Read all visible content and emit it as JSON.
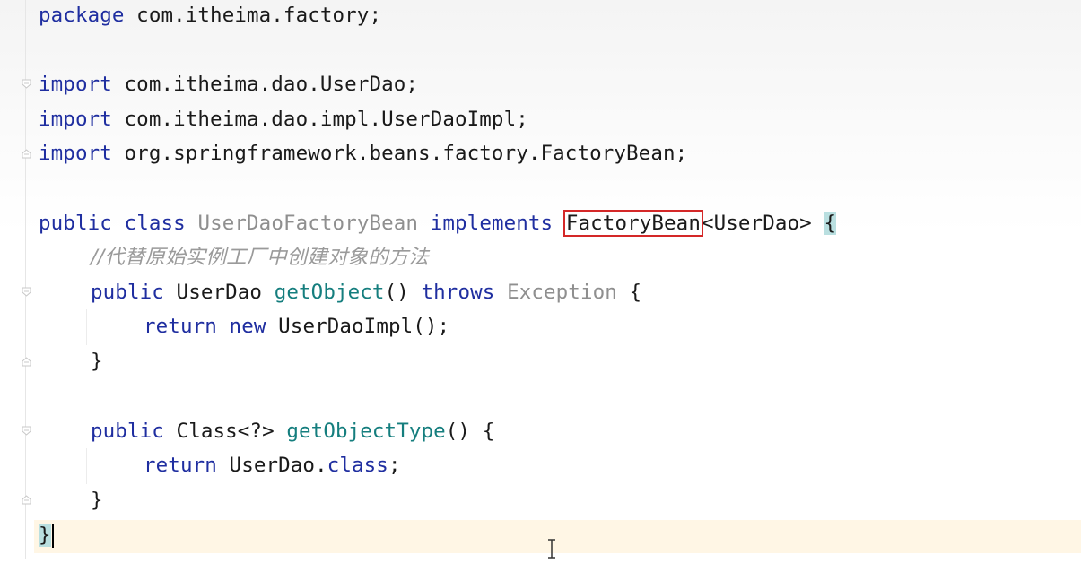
{
  "code": {
    "line1": {
      "kw": "package",
      "rest": " com.itheima.factory;"
    },
    "line3": {
      "kw": "import",
      "rest": " com.itheima.dao.UserDao;"
    },
    "line4": {
      "kw": "import",
      "rest": " com.itheima.dao.impl.UserDaoImpl;"
    },
    "line5": {
      "kw": "import",
      "rest": " org.springframework.beans.factory.FactoryBean;"
    },
    "line7": {
      "kw1": "public",
      "kw2": "class",
      "classname": "UserDaoFactoryBean",
      "kw3": "implements",
      "iface": "FactoryBean",
      "generic": "<UserDao>",
      "brace": "{"
    },
    "line8": {
      "comment": "//代替原始实例工厂中创建对象的方法"
    },
    "line9": {
      "kw1": "public",
      "type": "UserDao",
      "method": "getObject",
      "params": "()",
      "kw2": "throws",
      "exc": "Exception",
      "brace": "{"
    },
    "line10": {
      "kw1": "return",
      "kw2": "new",
      "rest": "UserDaoImpl();"
    },
    "line11": {
      "brace": "}"
    },
    "line13": {
      "kw1": "public",
      "type": "Class<?>",
      "method": "getObjectType",
      "params": "()",
      "brace": "{"
    },
    "line14": {
      "kw1": "return",
      "type": "UserDao.",
      "kw2": "class",
      "semi": ";"
    },
    "line15": {
      "brace": "}"
    },
    "line16": {
      "brace": "}"
    }
  },
  "colors": {
    "keyword": "#1f2ea0",
    "method": "#157e7e",
    "comment": "#9a9a9a",
    "highlight_box": "#d42828",
    "brace_match": "#b9dfe0"
  }
}
